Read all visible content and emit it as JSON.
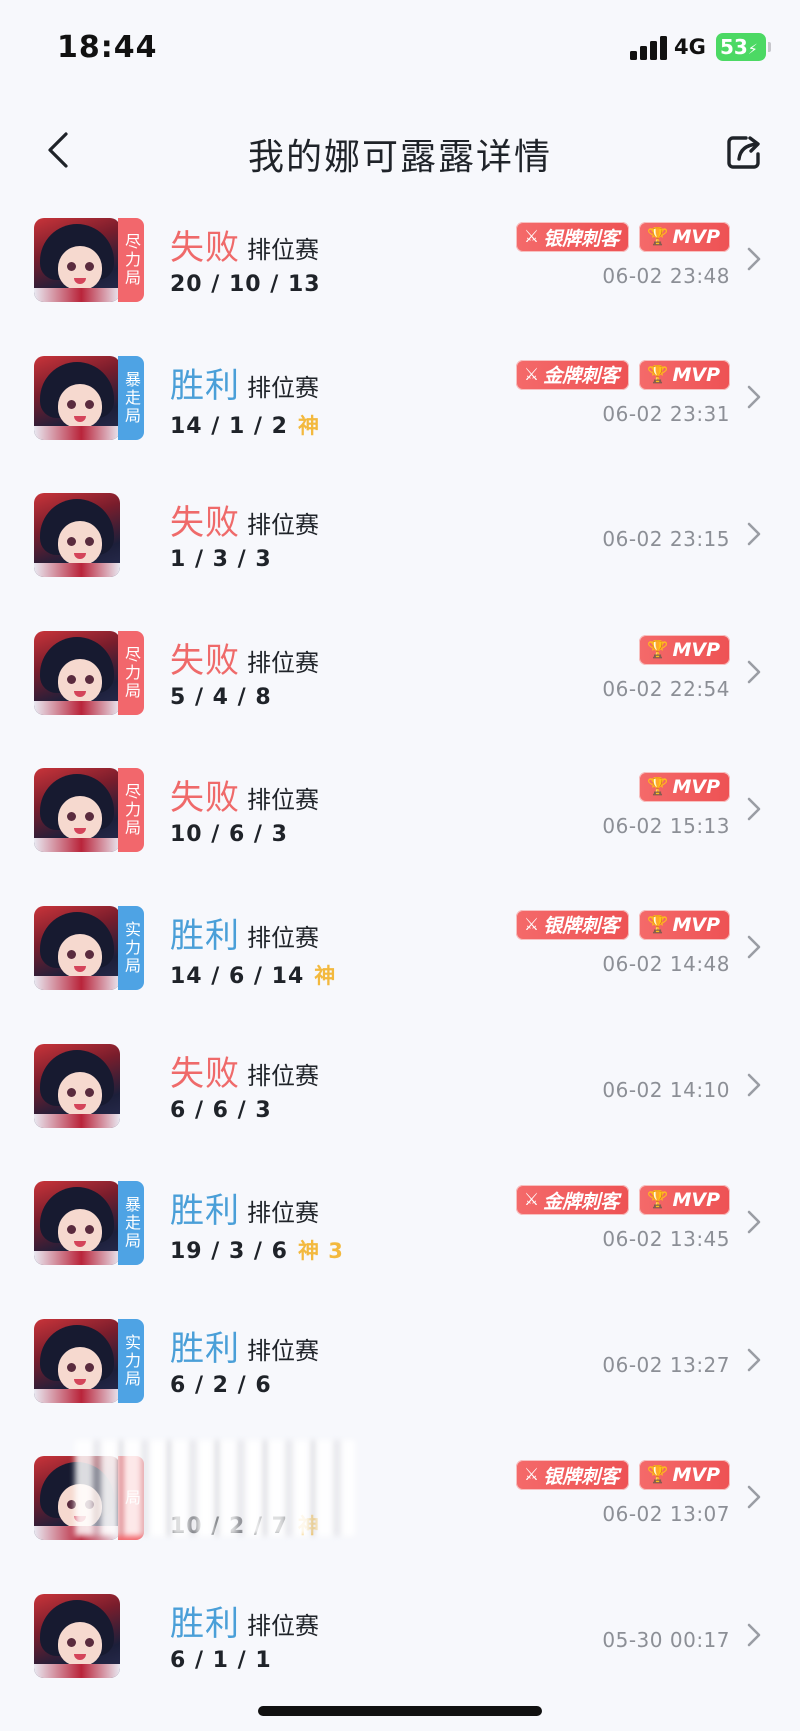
{
  "status_bar": {
    "time": "18:44",
    "network": "4G",
    "battery": "53"
  },
  "header": {
    "title": "我的娜可露露详情"
  },
  "colors": {
    "lose": "#ef6a6a",
    "win": "#4a9fd8",
    "tier_red": "#f2676c",
    "tier_blue": "#4ea3e4",
    "god": "#f3b93e"
  },
  "matches": [
    {
      "result": "失败",
      "outcome": "lose",
      "mode": "排位赛",
      "kda": "20 / 10 / 13",
      "god": "",
      "tier": "尽力局",
      "tier_color": "red",
      "badges": [
        "银牌刺客",
        "MVP"
      ],
      "time": "06-02 23:48"
    },
    {
      "result": "胜利",
      "outcome": "win",
      "mode": "排位赛",
      "kda": "14 / 1 / 2",
      "god": "神",
      "tier": "暴走局",
      "tier_color": "blue",
      "badges": [
        "金牌刺客",
        "MVP"
      ],
      "time": "06-02 23:31"
    },
    {
      "result": "失败",
      "outcome": "lose",
      "mode": "排位赛",
      "kda": "1 / 3 / 3",
      "god": "",
      "tier": "",
      "tier_color": "",
      "badges": [],
      "time": "06-02 23:15"
    },
    {
      "result": "失败",
      "outcome": "lose",
      "mode": "排位赛",
      "kda": "5 / 4 / 8",
      "god": "",
      "tier": "尽力局",
      "tier_color": "red",
      "badges": [
        "MVP"
      ],
      "time": "06-02 22:54"
    },
    {
      "result": "失败",
      "outcome": "lose",
      "mode": "排位赛",
      "kda": "10 / 6 / 3",
      "god": "",
      "tier": "尽力局",
      "tier_color": "red",
      "badges": [
        "MVP"
      ],
      "time": "06-02 15:13"
    },
    {
      "result": "胜利",
      "outcome": "win",
      "mode": "排位赛",
      "kda": "14 / 6 / 14",
      "god": "神",
      "tier": "实力局",
      "tier_color": "blue",
      "badges": [
        "银牌刺客",
        "MVP"
      ],
      "time": "06-02 14:48"
    },
    {
      "result": "失败",
      "outcome": "lose",
      "mode": "排位赛",
      "kda": "6 / 6 / 3",
      "god": "",
      "tier": "",
      "tier_color": "",
      "badges": [],
      "time": "06-02 14:10"
    },
    {
      "result": "胜利",
      "outcome": "win",
      "mode": "排位赛",
      "kda": "19 / 3 / 6",
      "god": "神 3",
      "tier": "暴走局",
      "tier_color": "blue",
      "badges": [
        "金牌刺客",
        "MVP"
      ],
      "time": "06-02 13:45"
    },
    {
      "result": "胜利",
      "outcome": "win",
      "mode": "排位赛",
      "kda": "6 / 2 / 6",
      "god": "",
      "tier": "实力局",
      "tier_color": "blue",
      "badges": [],
      "time": "06-02 13:27"
    },
    {
      "result": "",
      "outcome": "lose",
      "mode": "",
      "kda": "10 / 2 / 7",
      "god": "神",
      "tier": "局",
      "tier_color": "red",
      "badges": [
        "银牌刺客",
        "MVP"
      ],
      "time": "06-02 13:07"
    },
    {
      "result": "胜利",
      "outcome": "win",
      "mode": "排位赛",
      "kda": "6 / 1 / 1",
      "god": "",
      "tier": "",
      "tier_color": "",
      "badges": [],
      "time": "05-30 00:17"
    }
  ]
}
